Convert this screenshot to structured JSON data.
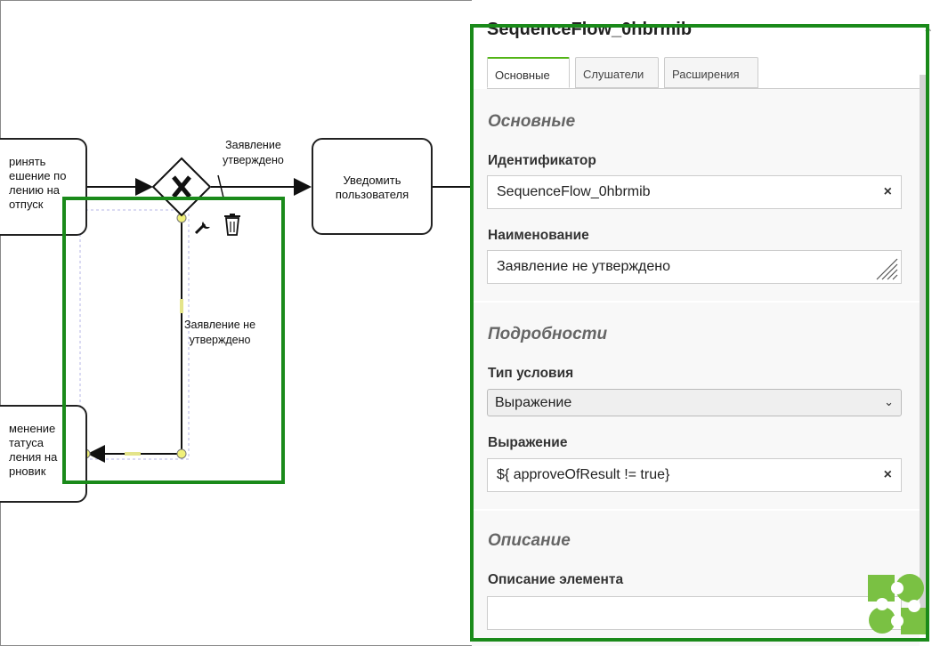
{
  "diagram": {
    "task_left_top": [
      "ринять",
      "ешение по",
      "лению на",
      "отпуск"
    ],
    "task_left_bottom": [
      "менение",
      "татуса",
      "ления на",
      "рновик"
    ],
    "task_notify": [
      "Уведомить",
      "пользователя"
    ],
    "flow_approved_label": [
      "Заявление",
      "утверждено"
    ],
    "flow_rejected_label": [
      "Заявление не",
      "утверждено"
    ],
    "gateway_icon": "x-icon",
    "script_icon": "script-icon",
    "context_icons": [
      "wrench-icon",
      "trash-icon"
    ]
  },
  "panel": {
    "title": "SequenceFlow_0hbrmib",
    "tabs": [
      {
        "label": "Основные",
        "active": true
      },
      {
        "label": "Слушатели",
        "active": false
      },
      {
        "label": "Расширения",
        "active": false
      }
    ],
    "group_main": "Основные",
    "id_label": "Идентификатор",
    "id_value": "SequenceFlow_0hbrmib",
    "name_label": "Наименование",
    "name_value": "Заявление не утверждено",
    "group_details": "Подробности",
    "condition_type_label": "Тип условия",
    "condition_type_value": "Выражение",
    "expression_label": "Выражение",
    "expression_value": "${ approveOfResult != true}",
    "group_description": "Описание",
    "description_label": "Описание элемента",
    "description_value": "",
    "clear_glyph": "×",
    "logo_icon": "puzzle-logo-icon"
  },
  "colors": {
    "highlight": "#1a8a1a",
    "tab_accent": "#52b415",
    "logo": "#7ac143",
    "selection_handle": "#f0f07a"
  }
}
